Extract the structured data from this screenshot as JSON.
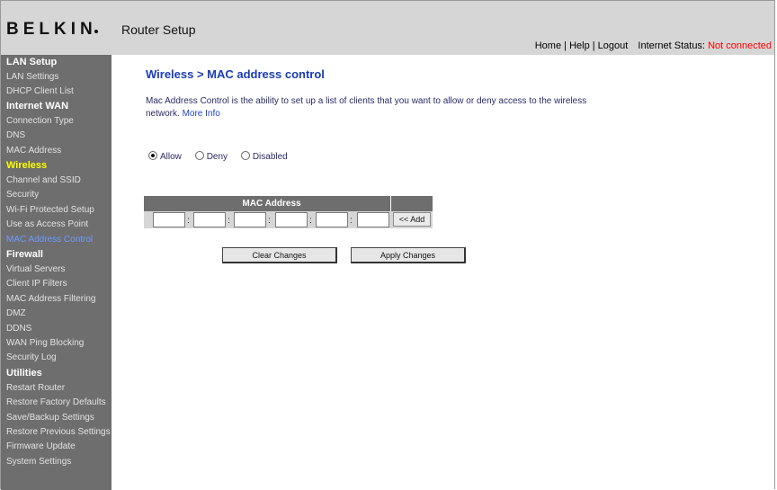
{
  "header": {
    "brand": "BELKIN",
    "app_title": "Router Setup",
    "nav": {
      "home": "Home",
      "help": "Help",
      "logout": "Logout",
      "sep": "|"
    },
    "status_label": "Internet Status:",
    "status_value": "Not connected",
    "status_color": "#ff0000"
  },
  "sidebar": {
    "sections": [
      {
        "label": "LAN Setup",
        "items": [
          "LAN Settings",
          "DHCP Client List"
        ]
      },
      {
        "label": "Internet WAN",
        "items": [
          "Connection Type",
          "DNS",
          "MAC Address"
        ]
      },
      {
        "label": "Wireless",
        "items": [
          "Channel and SSID",
          "Security",
          "Wi-Fi Protected Setup",
          "Use as Access Point",
          "MAC Address Control"
        ]
      },
      {
        "label": "Firewall",
        "items": [
          "Virtual Servers",
          "Client IP Filters",
          "MAC Address Filtering",
          "DMZ",
          "DDNS",
          "WAN Ping Blocking",
          "Security Log"
        ]
      },
      {
        "label": "Utilities",
        "items": [
          "Restart Router",
          "Restore Factory Defaults",
          "Save/Backup Settings",
          "Restore Previous Settings",
          "Firmware Update",
          "System Settings"
        ]
      }
    ],
    "active_section": "Wireless",
    "active_item": "MAC Address Control"
  },
  "main": {
    "title": "Wireless > MAC address control",
    "description": "Mac Address Control is the ability to set up a list of clients that you want to allow or deny access to the wireless network.",
    "more_info": "More Info",
    "radios": [
      {
        "label": "Allow",
        "checked": true
      },
      {
        "label": "Deny",
        "checked": false
      },
      {
        "label": "Disabled",
        "checked": false
      }
    ],
    "mac_table": {
      "header": "MAC Address",
      "octets": [
        "",
        "",
        "",
        "",
        "",
        ""
      ],
      "colon": ":",
      "add_label": "<< Add"
    },
    "buttons": {
      "clear": "Clear Changes",
      "apply": "Apply Changes"
    }
  },
  "colors": {
    "sidebar_bg": "#6e6e6e",
    "header_bg": "#d6d6d6",
    "title_blue": "#1a3cb5",
    "active_section": "#ffff00",
    "active_item": "#6b9cff"
  }
}
